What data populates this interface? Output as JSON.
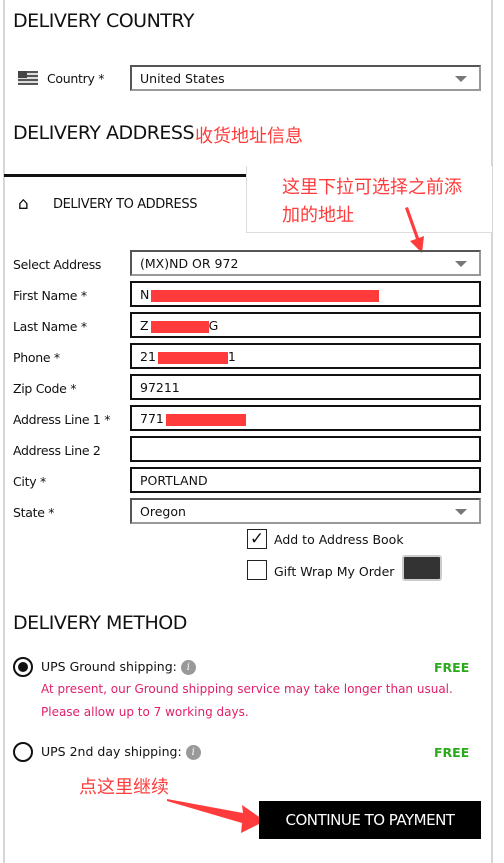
{
  "delivery_country": {
    "title": "DELIVERY COUNTRY",
    "country_label": "Country *",
    "country_value": "United States",
    "flag_icon": "us-flag-icon"
  },
  "delivery_address": {
    "title": "DELIVERY ADDRESS",
    "annotation": "收货地址信息",
    "tab_label": "DELIVERY TO ADDRESS",
    "tab_icon": "home-icon",
    "dropdown_annotation_line1": "这里下拉可选择之前添",
    "dropdown_annotation_line2": "加的地址",
    "fields": [
      {
        "label": "Select Address",
        "prefix": "(MX)",
        "suffix": "ND OR 972",
        "type": "select"
      },
      {
        "label": "First Name *",
        "prefix": "N",
        "suffix": ""
      },
      {
        "label": "Last Name *",
        "prefix": "Z",
        "suffix": "G"
      },
      {
        "label": "Phone *",
        "prefix": "21",
        "suffix": "1"
      },
      {
        "label": "Zip Code *",
        "prefix": "97211",
        "suffix": ""
      },
      {
        "label": "Address Line 1 *",
        "prefix": "771",
        "suffix": ""
      },
      {
        "label": "Address Line 2",
        "prefix": "",
        "suffix": ""
      },
      {
        "label": "City *",
        "prefix": "PORTLAND",
        "suffix": ""
      },
      {
        "label": "State *",
        "prefix": "Oregon",
        "suffix": "",
        "type": "select"
      }
    ],
    "add_to_address_book": {
      "label": "Add to Address Book",
      "checked": true
    },
    "gift_wrap": {
      "label": "Gift Wrap My Order",
      "checked": false
    }
  },
  "delivery_method": {
    "title": "DELIVERY METHOD",
    "options": [
      {
        "label": "UPS Ground shipping:",
        "price": "FREE",
        "selected": true,
        "note_line1": "At present, our Ground shipping service may take longer than usual.",
        "note_line2": "Please allow up to 7 working days."
      },
      {
        "label": "UPS 2nd day shipping:",
        "price": "FREE",
        "selected": false
      }
    ],
    "continue_annotation": "点这里继续",
    "continue_button": "CONTINUE TO PAYMENT"
  },
  "colors": {
    "annotation": "#ff3b3b",
    "free": "#2aaa1a",
    "note": "#e0206a"
  }
}
